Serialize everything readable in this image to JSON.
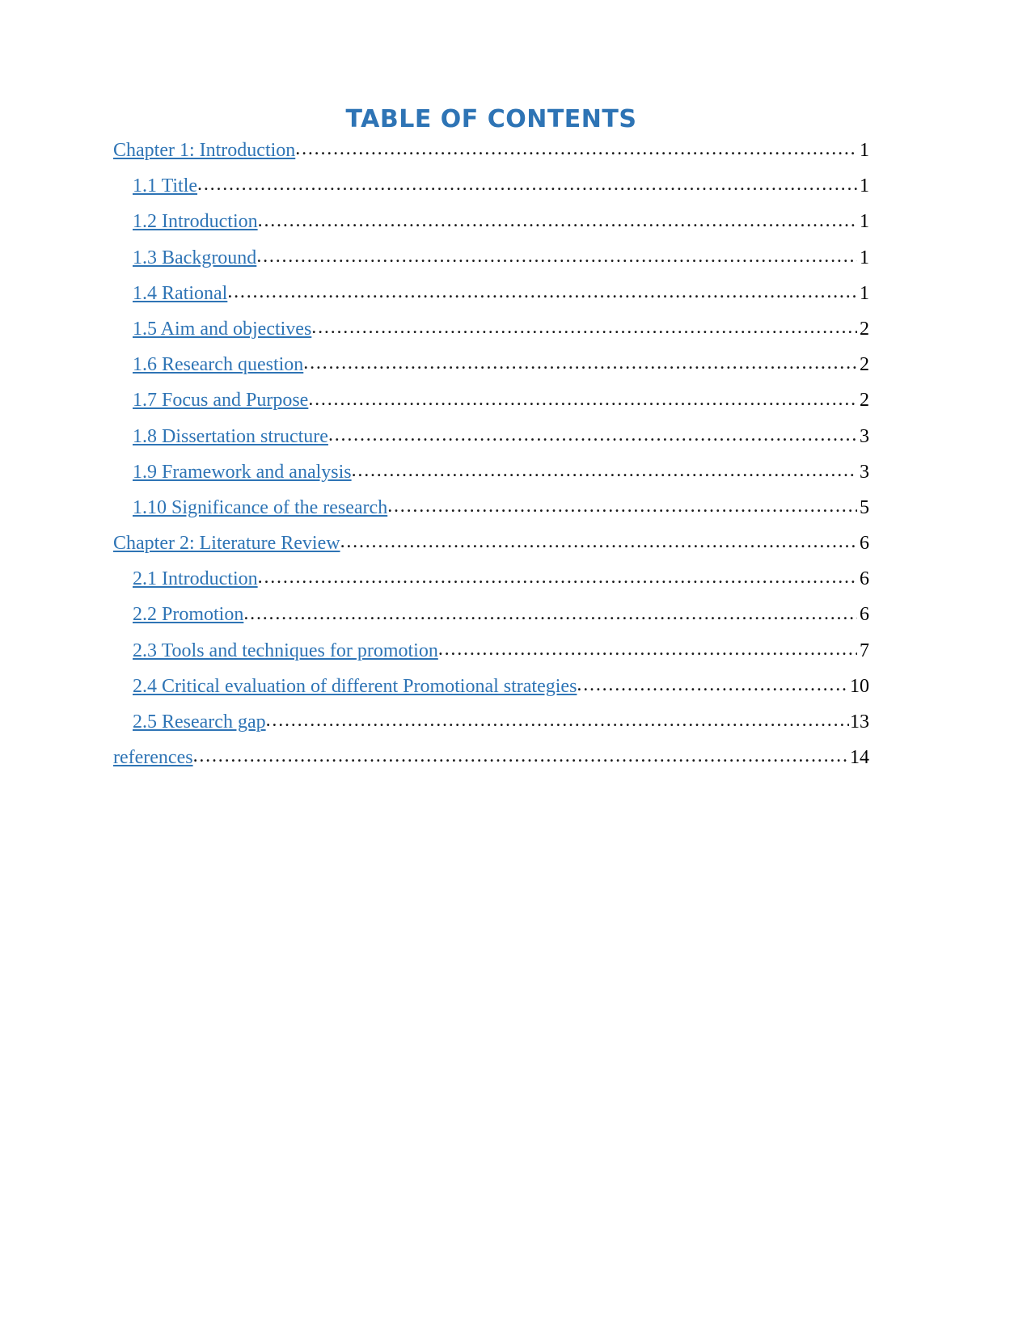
{
  "document": {
    "title": "TABLE OF CONTENTS",
    "title_color": "#2E74B5",
    "link_color": "#2E74B5",
    "leader_color": "#1a1a1a",
    "page_number_color": "#000000",
    "background": "#ffffff"
  },
  "toc": {
    "entries": [
      {
        "label": "Chapter 1: Introduction",
        "page": "1",
        "level": 1
      },
      {
        "label": "1.1 Title",
        "page": "1",
        "level": 2
      },
      {
        "label": "1.2 Introduction",
        "page": "1",
        "level": 2
      },
      {
        "label": "1.3 Background",
        "page": "1",
        "level": 2
      },
      {
        "label": "1.4 Rational",
        "page": "1",
        "level": 2
      },
      {
        "label": "1.5 Aim and objectives",
        "page": "2",
        "level": 2
      },
      {
        "label": "1.6 Research question",
        "page": "2",
        "level": 2
      },
      {
        "label": "1.7 Focus and Purpose",
        "page": "2",
        "level": 2
      },
      {
        "label": "1.8 Dissertation structure",
        "page": "3",
        "level": 2
      },
      {
        "label": "1.9 Framework and analysis",
        "page": "3",
        "level": 2
      },
      {
        "label": "1.10 Significance of the research",
        "page": "5",
        "level": 2
      },
      {
        "label": "Chapter 2:  Literature Review",
        "page": "6",
        "level": 1
      },
      {
        "label": "2.1 Introduction",
        "page": "6",
        "level": 2
      },
      {
        "label": "2.2 Promotion",
        "page": "6",
        "level": 2
      },
      {
        "label": "2.3 Tools and techniques for promotion",
        "page": "7",
        "level": 2
      },
      {
        "label": "2.4 Critical evaluation of different Promotional strategies",
        "page": "10",
        "level": 2
      },
      {
        "label": "2.5 Research gap",
        "page": "13",
        "level": 2
      },
      {
        "label": "references",
        "page": "14",
        "level": 1
      }
    ],
    "leader_character": "."
  }
}
